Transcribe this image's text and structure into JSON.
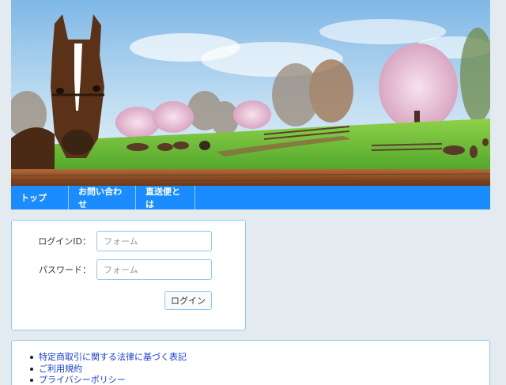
{
  "header": {
    "image": "horse-ranch-banner"
  },
  "nav": {
    "items": [
      {
        "label": "トップ"
      },
      {
        "label": "お問い合わせ"
      },
      {
        "label": "直送便とは"
      }
    ]
  },
  "login": {
    "id_label": "ログインID：",
    "id_placeholder": "フォーム",
    "password_label": "パスワード：",
    "password_placeholder": "フォーム",
    "button_label": "ログイン"
  },
  "footer_links": {
    "items": [
      {
        "label": "特定商取引に関する法律に基づく表記"
      },
      {
        "label": "ご利用規約"
      },
      {
        "label": "プライバシーポリシー"
      }
    ]
  },
  "colors": {
    "page_bg": "#e4ebf0",
    "nav_bg": "#1a8cff",
    "panel_border": "#8fc8ee",
    "link": "#1a3fd6"
  }
}
